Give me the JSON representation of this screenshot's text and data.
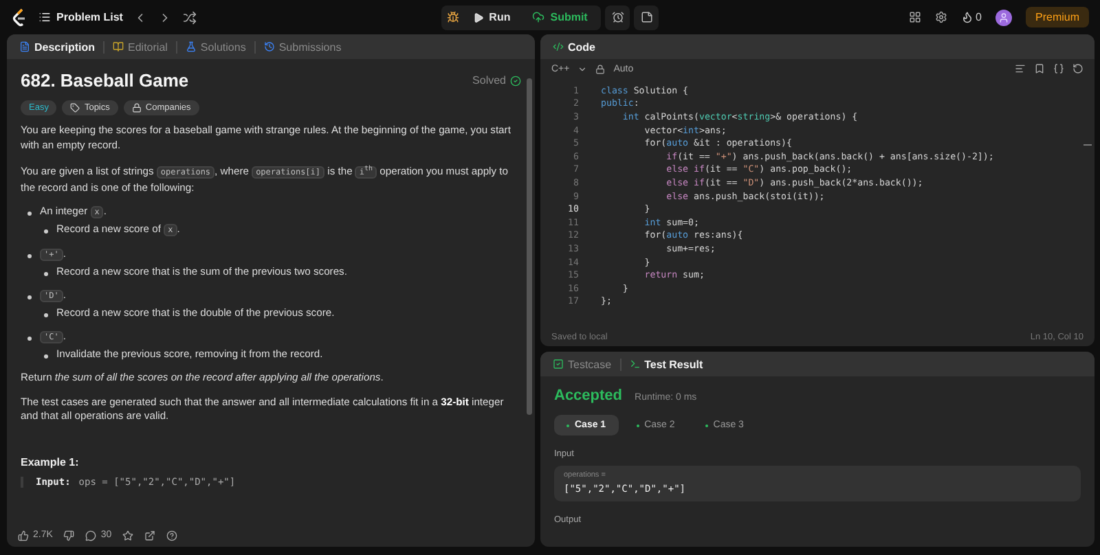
{
  "topbar": {
    "breadcrumb": "Problem List",
    "run": "Run",
    "submit": "Submit",
    "streak": "0",
    "premium": "Premium"
  },
  "description_panel": {
    "tabs": [
      {
        "label": "Description",
        "selected": true
      },
      {
        "label": "Editorial",
        "selected": false
      },
      {
        "label": "Solutions",
        "selected": false
      },
      {
        "label": "Submissions",
        "selected": false
      }
    ],
    "title": "682. Baseball Game",
    "status": "Solved",
    "difficulty": "Easy",
    "tags": [
      "Topics",
      "Companies"
    ],
    "blocks": [
      {
        "kind": "para",
        "segments": [
          {
            "kind": "text",
            "text": "You are keeping the scores for a baseball game with strange rules. At the beginning of the game, you start with an empty record."
          }
        ]
      },
      {
        "kind": "para",
        "segments": [
          {
            "kind": "text",
            "text": "You are given a list of strings "
          },
          {
            "kind": "code",
            "text": "operations"
          },
          {
            "kind": "text",
            "text": ", where "
          },
          {
            "kind": "code",
            "text": "operations[i]"
          },
          {
            "kind": "text",
            "text": " is the "
          },
          {
            "kind": "code",
            "text": "i$^{th}$"
          },
          {
            "kind": "text",
            "text": " operation you must apply to the record and is one of the following:"
          }
        ]
      },
      {
        "kind": "bullet",
        "segments": [
          {
            "kind": "text",
            "text": "An integer "
          },
          {
            "kind": "code",
            "text": "x"
          },
          {
            "kind": "text",
            "text": "."
          }
        ],
        "children": [
          {
            "segments": [
              {
                "kind": "text",
                "text": "Record a new score of "
              },
              {
                "kind": "code",
                "text": "x"
              },
              {
                "kind": "text",
                "text": "."
              }
            ]
          }
        ]
      },
      {
        "kind": "bullet",
        "segments": [
          {
            "kind": "code",
            "text": "'+'"
          },
          {
            "kind": "text",
            "text": "."
          }
        ],
        "children": [
          {
            "segments": [
              {
                "kind": "text",
                "text": "Record a new score that is the sum of the previous two scores."
              }
            ]
          }
        ]
      },
      {
        "kind": "bullet",
        "segments": [
          {
            "kind": "code",
            "text": "'D'"
          },
          {
            "kind": "text",
            "text": "."
          }
        ],
        "children": [
          {
            "segments": [
              {
                "kind": "text",
                "text": "Record a new score that is the double of the previous score."
              }
            ]
          }
        ]
      },
      {
        "kind": "bullet",
        "segments": [
          {
            "kind": "code",
            "text": "'C'"
          },
          {
            "kind": "text",
            "text": "."
          }
        ],
        "children": [
          {
            "segments": [
              {
                "kind": "text",
                "text": "Invalidate the previous score, removing it from the record."
              }
            ]
          }
        ]
      },
      {
        "kind": "para",
        "segments": [
          {
            "kind": "text",
            "text": "Return *the sum of all the scores on the record after applying all the operations*."
          }
        ]
      },
      {
        "kind": "para",
        "segments": [
          {
            "kind": "text",
            "text": "The test cases are generated such that the answer and all intermediate calculations fit in a **32-bit** integer and that all operations are valid."
          }
        ]
      }
    ],
    "example_title": "Example 1:",
    "example_input_label": "Input:",
    "example_input_value": "ops = [\"5\",\"2\",\"C\",\"D\",\"+\"]",
    "footer": {
      "likes": "2.7K",
      "comments": "30"
    }
  },
  "code_panel": {
    "title": "Code",
    "language": "C++",
    "mode": "Auto",
    "lines": [
      {
        "n": "1",
        "current": false,
        "tokens": [
          {
            "text": "class",
            "color": "#569cd6"
          },
          {
            "text": " Solution {",
            "color": "#d4d4d4"
          }
        ]
      },
      {
        "n": "2",
        "current": false,
        "tokens": [
          {
            "text": "public",
            "color": "#569cd6"
          },
          {
            "text": ":",
            "color": "#d4d4d4"
          }
        ]
      },
      {
        "n": "3",
        "current": false,
        "tokens": [
          {
            "text": "    int",
            "color": "#569cd6"
          },
          {
            "text": " calPoints(",
            "color": "#d4d4d4"
          },
          {
            "text": "vector",
            "color": "#4ec9b0"
          },
          {
            "text": "<",
            "color": "#d4d4d4"
          },
          {
            "text": "string",
            "color": "#4ec9b0"
          },
          {
            "text": ">& operations) {",
            "color": "#d4d4d4"
          }
        ]
      },
      {
        "n": "4",
        "current": false,
        "tokens": [
          {
            "text": "        vector<",
            "color": "#d4d4d4"
          },
          {
            "text": "int",
            "color": "#569cd6"
          },
          {
            "text": ">ans;",
            "color": "#d4d4d4"
          }
        ]
      },
      {
        "n": "5",
        "current": false,
        "tokens": [
          {
            "text": "        for(",
            "color": "#d4d4d4"
          },
          {
            "text": "auto",
            "color": "#569cd6"
          },
          {
            "text": " &it : operations){",
            "color": "#d4d4d4"
          }
        ]
      },
      {
        "n": "6",
        "current": false,
        "tokens": [
          {
            "text": "            if",
            "color": "#c586c0"
          },
          {
            "text": "(it == ",
            "color": "#d4d4d4"
          },
          {
            "text": "\"+\"",
            "color": "#ce9178"
          },
          {
            "text": ") ans.push_back(ans.back() + ans[ans.size()-2]);",
            "color": "#d4d4d4"
          }
        ]
      },
      {
        "n": "7",
        "current": false,
        "tokens": [
          {
            "text": "            else if",
            "color": "#c586c0"
          },
          {
            "text": "(it == ",
            "color": "#d4d4d4"
          },
          {
            "text": "\"C\"",
            "color": "#ce9178"
          },
          {
            "text": ") ans.pop_back();",
            "color": "#d4d4d4"
          }
        ]
      },
      {
        "n": "8",
        "current": false,
        "tokens": [
          {
            "text": "            else if",
            "color": "#c586c0"
          },
          {
            "text": "(it == ",
            "color": "#d4d4d4"
          },
          {
            "text": "\"D\"",
            "color": "#ce9178"
          },
          {
            "text": ") ans.push_back(2*ans.back());",
            "color": "#d4d4d4"
          }
        ]
      },
      {
        "n": "9",
        "current": false,
        "tokens": [
          {
            "text": "            else",
            "color": "#c586c0"
          },
          {
            "text": " ans.push_back(stoi(it));",
            "color": "#d4d4d4"
          }
        ]
      },
      {
        "n": "10",
        "current": true,
        "tokens": [
          {
            "text": "        }",
            "color": "#d4d4d4"
          }
        ]
      },
      {
        "n": "11",
        "current": false,
        "tokens": [
          {
            "text": "        int",
            "color": "#569cd6"
          },
          {
            "text": " sum=0;",
            "color": "#d4d4d4"
          }
        ]
      },
      {
        "n": "12",
        "current": false,
        "tokens": [
          {
            "text": "        for(",
            "color": "#d4d4d4"
          },
          {
            "text": "auto",
            "color": "#569cd6"
          },
          {
            "text": " res:ans){",
            "color": "#d4d4d4"
          }
        ]
      },
      {
        "n": "13",
        "current": false,
        "tokens": [
          {
            "text": "            sum+=res;",
            "color": "#d4d4d4"
          }
        ]
      },
      {
        "n": "14",
        "current": false,
        "tokens": [
          {
            "text": "        }",
            "color": "#d4d4d4"
          }
        ]
      },
      {
        "n": "15",
        "current": false,
        "tokens": [
          {
            "text": "        return",
            "color": "#c586c0"
          },
          {
            "text": " sum;",
            "color": "#d4d4d4"
          }
        ]
      },
      {
        "n": "16",
        "current": false,
        "tokens": [
          {
            "text": "    }",
            "color": "#d4d4d4"
          }
        ]
      },
      {
        "n": "17",
        "current": false,
        "tokens": [
          {
            "text": "};",
            "color": "#d4d4d4"
          }
        ]
      }
    ],
    "status": "Saved to local",
    "cursor": "Ln 10, Col 10"
  },
  "result_panel": {
    "tabs": [
      {
        "label": "Testcase",
        "selected": false
      },
      {
        "label": "Test Result",
        "selected": true
      }
    ],
    "verdict": "Accepted",
    "runtime": "Runtime: 0 ms",
    "cases": [
      {
        "label": "Case 1",
        "selected": true
      },
      {
        "label": "Case 2",
        "selected": false
      },
      {
        "label": "Case 3",
        "selected": false
      }
    ],
    "input_label": "Input",
    "param_name": "operations =",
    "param_value": "[\"5\",\"2\",\"C\",\"D\",\"+\"]",
    "output_label": "Output"
  }
}
